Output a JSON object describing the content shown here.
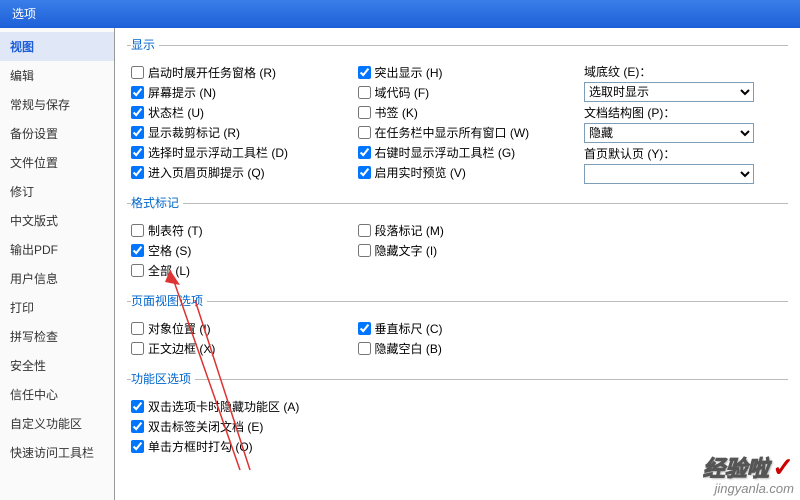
{
  "title": "选项",
  "sidebar": {
    "items": [
      {
        "label": "视图",
        "selected": true
      },
      {
        "label": "编辑"
      },
      {
        "label": "常规与保存"
      },
      {
        "label": "备份设置"
      },
      {
        "label": "文件位置"
      },
      {
        "label": "修订"
      },
      {
        "label": "中文版式"
      },
      {
        "label": "输出PDF"
      },
      {
        "label": "用户信息"
      },
      {
        "label": "打印"
      },
      {
        "label": "拼写检查"
      },
      {
        "label": "安全性"
      },
      {
        "label": "信任中心"
      },
      {
        "label": "自定义功能区"
      },
      {
        "label": "快速访问工具栏"
      }
    ]
  },
  "groups": {
    "display": {
      "legend": "显示",
      "col1": [
        {
          "label": "启动时展开任务窗格 (R)",
          "checked": false
        },
        {
          "label": "屏幕提示 (N)",
          "checked": true
        },
        {
          "label": "状态栏 (U)",
          "checked": true
        },
        {
          "label": "显示裁剪标记 (R)",
          "checked": true
        },
        {
          "label": "选择时显示浮动工具栏 (D)",
          "checked": true
        },
        {
          "label": "进入页眉页脚提示 (Q)",
          "checked": true
        }
      ],
      "col2": [
        {
          "label": "突出显示 (H)",
          "checked": true
        },
        {
          "label": "域代码 (F)",
          "checked": false
        },
        {
          "label": "书签 (K)",
          "checked": false
        },
        {
          "label": "在任务栏中显示所有窗口 (W)",
          "checked": false
        },
        {
          "label": "右键时显示浮动工具栏 (G)",
          "checked": true
        },
        {
          "label": "启用实时预览 (V)",
          "checked": true
        }
      ],
      "col3": {
        "dd1_label": "域底纹 (E)：",
        "dd1_value": "选取时显示",
        "dd2_label": "文档结构图 (P)：",
        "dd2_value": "隐藏",
        "dd3_label": "首页默认页 (Y)：",
        "dd3_value": ""
      }
    },
    "format": {
      "legend": "格式标记",
      "col1": [
        {
          "label": "制表符 (T)",
          "checked": false
        },
        {
          "label": "空格 (S)",
          "checked": true
        },
        {
          "label": "全部 (L)",
          "checked": false
        }
      ],
      "col2": [
        {
          "label": "段落标记 (M)",
          "checked": false
        },
        {
          "label": "隐藏文字 (I)",
          "checked": false
        }
      ]
    },
    "pageview": {
      "legend": "页面视图选项",
      "col1": [
        {
          "label": "对象位置 (I)",
          "checked": false
        },
        {
          "label": "正文边框 (X)",
          "checked": false
        }
      ],
      "col2": [
        {
          "label": "垂直标尺 (C)",
          "checked": true
        },
        {
          "label": "隐藏空白 (B)",
          "checked": false
        }
      ]
    },
    "ribbon": {
      "legend": "功能区选项",
      "items": [
        {
          "label": "双击选项卡时隐藏功能区 (A)",
          "checked": true
        },
        {
          "label": "双击标签关闭文档 (E)",
          "checked": true
        },
        {
          "label": "单击方框时打勾 (O)",
          "checked": true
        }
      ]
    }
  },
  "watermark": {
    "brand": "经验啦",
    "url": "jingyanla.com",
    "check": "✓"
  }
}
